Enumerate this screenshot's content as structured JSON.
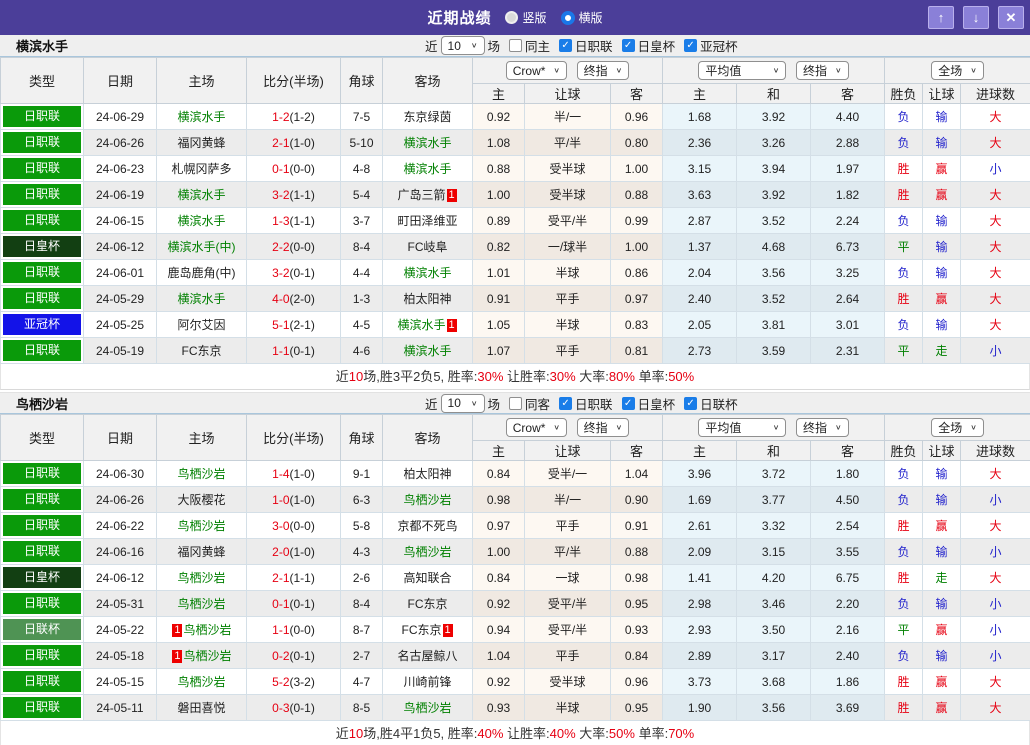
{
  "titlebar": {
    "title": "近期战绩",
    "radio_vertical": "竖版",
    "radio_horizontal": "横版",
    "selected": "横版"
  },
  "icons": {
    "up": "↑",
    "down": "↓",
    "close": "✕",
    "check": "✓",
    "chevron": "∨"
  },
  "labels": {
    "near": "近",
    "count": "10",
    "matches": "场"
  },
  "columns": {
    "type": "类型",
    "date": "日期",
    "home": "主场",
    "score": "比分(半场)",
    "corner": "角球",
    "away": "客场",
    "odds_home": "主",
    "odds_line": "让球",
    "odds_away": "客",
    "avg_home": "主",
    "avg_draw": "和",
    "avg_away": "客",
    "result_wdl": "胜负",
    "result_handicap": "让球",
    "result_goals": "进球数"
  },
  "dropdowns": {
    "source": "Crow*",
    "final": "终指",
    "average": "平均值",
    "scope": "全场"
  },
  "league_colors": {
    "日职联": "#0a9a0a",
    "日皇杯": "#123f12",
    "亚冠杯": "#1313e8",
    "日联杯": "#4f9354"
  },
  "value_colors": {
    "胜": "#e60012",
    "赢": "#e60012",
    "大": "#e60012",
    "负": "#2222cc",
    "输": "#2222cc",
    "小": "#2222cc",
    "平": "#008000",
    "走": "#008000"
  },
  "sections": [
    {
      "team": "横滨水手",
      "same_label": "同主",
      "same_checked": false,
      "leagues": [
        "日职联",
        "日皇杯",
        "亚冠杯"
      ],
      "rows": [
        {
          "league": "日职联",
          "date": "24-06-29",
          "home": {
            "name": "横滨水手",
            "green": true
          },
          "score": "1-2",
          "half": "(1-2)",
          "corners": "7-5",
          "away": {
            "name": "东京绿茵",
            "green": false
          },
          "odds": [
            "0.92",
            "半/一",
            "0.96"
          ],
          "avg": [
            "1.68",
            "3.92",
            "4.40"
          ],
          "results": [
            "负",
            "输",
            "大"
          ]
        },
        {
          "league": "日职联",
          "date": "24-06-26",
          "home": {
            "name": "福冈黄蜂",
            "green": false
          },
          "score": "2-1",
          "half": "(1-0)",
          "corners": "5-10",
          "away": {
            "name": "横滨水手",
            "green": true
          },
          "odds": [
            "1.08",
            "平/半",
            "0.80"
          ],
          "avg": [
            "2.36",
            "3.26",
            "2.88"
          ],
          "results": [
            "负",
            "输",
            "大"
          ]
        },
        {
          "league": "日职联",
          "date": "24-06-23",
          "home": {
            "name": "札幌冈萨多",
            "green": false
          },
          "score": "0-1",
          "half": "(0-0)",
          "corners": "4-8",
          "away": {
            "name": "横滨水手",
            "green": true
          },
          "odds": [
            "0.88",
            "受半球",
            "1.00"
          ],
          "avg": [
            "3.15",
            "3.94",
            "1.97"
          ],
          "results": [
            "胜",
            "赢",
            "小"
          ]
        },
        {
          "league": "日职联",
          "date": "24-06-19",
          "home": {
            "name": "横滨水手",
            "green": true
          },
          "score": "3-2",
          "half": "(1-1)",
          "corners": "5-4",
          "away": {
            "name": "广岛三箭",
            "green": false,
            "badge_after": "1"
          },
          "odds": [
            "1.00",
            "受半球",
            "0.88"
          ],
          "avg": [
            "3.63",
            "3.92",
            "1.82"
          ],
          "results": [
            "胜",
            "赢",
            "大"
          ]
        },
        {
          "league": "日职联",
          "date": "24-06-15",
          "home": {
            "name": "横滨水手",
            "green": true
          },
          "score": "1-3",
          "half": "(1-1)",
          "corners": "3-7",
          "away": {
            "name": "町田泽维亚",
            "green": false
          },
          "odds": [
            "0.89",
            "受平/半",
            "0.99"
          ],
          "avg": [
            "2.87",
            "3.52",
            "2.24"
          ],
          "results": [
            "负",
            "输",
            "大"
          ]
        },
        {
          "league": "日皇杯",
          "date": "24-06-12",
          "home": {
            "name": "横滨水手(中)",
            "green": true
          },
          "score": "2-2",
          "half": "(0-0)",
          "corners": "8-4",
          "away": {
            "name": "FC岐阜",
            "green": false
          },
          "odds": [
            "0.82",
            "一/球半",
            "1.00"
          ],
          "avg": [
            "1.37",
            "4.68",
            "6.73"
          ],
          "results": [
            "平",
            "输",
            "大"
          ]
        },
        {
          "league": "日职联",
          "date": "24-06-01",
          "home": {
            "name": "鹿岛鹿角(中)",
            "green": false
          },
          "score": "3-2",
          "half": "(0-1)",
          "corners": "4-4",
          "away": {
            "name": "横滨水手",
            "green": true
          },
          "odds": [
            "1.01",
            "半球",
            "0.86"
          ],
          "avg": [
            "2.04",
            "3.56",
            "3.25"
          ],
          "results": [
            "负",
            "输",
            "大"
          ]
        },
        {
          "league": "日职联",
          "date": "24-05-29",
          "home": {
            "name": "横滨水手",
            "green": true
          },
          "score": "4-0",
          "half": "(2-0)",
          "corners": "1-3",
          "away": {
            "name": "柏太阳神",
            "green": false
          },
          "odds": [
            "0.91",
            "平手",
            "0.97"
          ],
          "avg": [
            "2.40",
            "3.52",
            "2.64"
          ],
          "results": [
            "胜",
            "赢",
            "大"
          ]
        },
        {
          "league": "亚冠杯",
          "date": "24-05-25",
          "home": {
            "name": "阿尔艾因",
            "green": false
          },
          "score": "5-1",
          "half": "(2-1)",
          "corners": "4-5",
          "away": {
            "name": "横滨水手",
            "green": true,
            "badge_after": "1"
          },
          "odds": [
            "1.05",
            "半球",
            "0.83"
          ],
          "avg": [
            "2.05",
            "3.81",
            "3.01"
          ],
          "results": [
            "负",
            "输",
            "大"
          ]
        },
        {
          "league": "日职联",
          "date": "24-05-19",
          "home": {
            "name": "FC东京",
            "green": false
          },
          "score": "1-1",
          "half": "(0-1)",
          "corners": "4-6",
          "away": {
            "name": "横滨水手",
            "green": true
          },
          "odds": [
            "1.07",
            "平手",
            "0.81"
          ],
          "avg": [
            "2.73",
            "3.59",
            "2.31"
          ],
          "results": [
            "平",
            "走",
            "小"
          ]
        }
      ],
      "summary": [
        {
          "text": "近"
        },
        {
          "text": "10",
          "red": true
        },
        {
          "text": "场,胜3平2负5, 胜率:"
        },
        {
          "text": "30%",
          "red": true
        },
        {
          "text": " 让胜率:"
        },
        {
          "text": "30%",
          "red": true
        },
        {
          "text": " 大率:"
        },
        {
          "text": "80%",
          "red": true
        },
        {
          "text": " 单率:"
        },
        {
          "text": "50%",
          "red": true
        }
      ]
    },
    {
      "team": "鸟栖沙岩",
      "same_label": "同客",
      "same_checked": false,
      "leagues": [
        "日职联",
        "日皇杯",
        "日联杯"
      ],
      "rows": [
        {
          "league": "日职联",
          "date": "24-06-30",
          "home": {
            "name": "鸟栖沙岩",
            "green": true
          },
          "score": "1-4",
          "half": "(1-0)",
          "corners": "9-1",
          "away": {
            "name": "柏太阳神",
            "green": false
          },
          "odds": [
            "0.84",
            "受半/一",
            "1.04"
          ],
          "avg": [
            "3.96",
            "3.72",
            "1.80"
          ],
          "results": [
            "负",
            "输",
            "大"
          ]
        },
        {
          "league": "日职联",
          "date": "24-06-26",
          "home": {
            "name": "大阪樱花",
            "green": false
          },
          "score": "1-0",
          "half": "(1-0)",
          "corners": "6-3",
          "away": {
            "name": "鸟栖沙岩",
            "green": true
          },
          "odds": [
            "0.98",
            "半/一",
            "0.90"
          ],
          "avg": [
            "1.69",
            "3.77",
            "4.50"
          ],
          "results": [
            "负",
            "输",
            "小"
          ]
        },
        {
          "league": "日职联",
          "date": "24-06-22",
          "home": {
            "name": "鸟栖沙岩",
            "green": true
          },
          "score": "3-0",
          "half": "(0-0)",
          "corners": "5-8",
          "away": {
            "name": "京都不死鸟",
            "green": false
          },
          "odds": [
            "0.97",
            "平手",
            "0.91"
          ],
          "avg": [
            "2.61",
            "3.32",
            "2.54"
          ],
          "results": [
            "胜",
            "赢",
            "大"
          ]
        },
        {
          "league": "日职联",
          "date": "24-06-16",
          "home": {
            "name": "福冈黄蜂",
            "green": false
          },
          "score": "2-0",
          "half": "(1-0)",
          "corners": "4-3",
          "away": {
            "name": "鸟栖沙岩",
            "green": true
          },
          "odds": [
            "1.00",
            "平/半",
            "0.88"
          ],
          "avg": [
            "2.09",
            "3.15",
            "3.55"
          ],
          "results": [
            "负",
            "输",
            "小"
          ]
        },
        {
          "league": "日皇杯",
          "date": "24-06-12",
          "home": {
            "name": "鸟栖沙岩",
            "green": true
          },
          "score": "2-1",
          "half": "(1-1)",
          "corners": "2-6",
          "away": {
            "name": "高知联合",
            "green": false
          },
          "odds": [
            "0.84",
            "一球",
            "0.98"
          ],
          "avg": [
            "1.41",
            "4.20",
            "6.75"
          ],
          "results": [
            "胜",
            "走",
            "大"
          ]
        },
        {
          "league": "日职联",
          "date": "24-05-31",
          "home": {
            "name": "鸟栖沙岩",
            "green": true
          },
          "score": "0-1",
          "half": "(0-1)",
          "corners": "8-4",
          "away": {
            "name": "FC东京",
            "green": false
          },
          "odds": [
            "0.92",
            "受平/半",
            "0.95"
          ],
          "avg": [
            "2.98",
            "3.46",
            "2.20"
          ],
          "results": [
            "负",
            "输",
            "小"
          ]
        },
        {
          "league": "日联杯",
          "date": "24-05-22",
          "home": {
            "name": "鸟栖沙岩",
            "green": true,
            "badge_before": "1"
          },
          "score": "1-1",
          "half": "(0-0)",
          "corners": "8-7",
          "away": {
            "name": "FC东京",
            "green": false,
            "badge_after": "1"
          },
          "odds": [
            "0.94",
            "受平/半",
            "0.93"
          ],
          "avg": [
            "2.93",
            "3.50",
            "2.16"
          ],
          "results": [
            "平",
            "赢",
            "小"
          ]
        },
        {
          "league": "日职联",
          "date": "24-05-18",
          "home": {
            "name": "鸟栖沙岩",
            "green": true,
            "badge_before": "1"
          },
          "score": "0-2",
          "half": "(0-1)",
          "corners": "2-7",
          "away": {
            "name": "名古屋鲸八",
            "green": false
          },
          "odds": [
            "1.04",
            "平手",
            "0.84"
          ],
          "avg": [
            "2.89",
            "3.17",
            "2.40"
          ],
          "results": [
            "负",
            "输",
            "小"
          ]
        },
        {
          "league": "日职联",
          "date": "24-05-15",
          "home": {
            "name": "鸟栖沙岩",
            "green": true
          },
          "score": "5-2",
          "half": "(3-2)",
          "corners": "4-7",
          "away": {
            "name": "川崎前锋",
            "green": false
          },
          "odds": [
            "0.92",
            "受半球",
            "0.96"
          ],
          "avg": [
            "3.73",
            "3.68",
            "1.86"
          ],
          "results": [
            "胜",
            "赢",
            "大"
          ]
        },
        {
          "league": "日职联",
          "date": "24-05-11",
          "home": {
            "name": "磐田喜悦",
            "green": false
          },
          "score": "0-3",
          "half": "(0-1)",
          "corners": "8-5",
          "away": {
            "name": "鸟栖沙岩",
            "green": true
          },
          "odds": [
            "0.93",
            "半球",
            "0.95"
          ],
          "avg": [
            "1.90",
            "3.56",
            "3.69"
          ],
          "results": [
            "胜",
            "赢",
            "大"
          ]
        }
      ],
      "summary": [
        {
          "text": "近"
        },
        {
          "text": "10",
          "red": true
        },
        {
          "text": "场,胜4平1负5, 胜率:"
        },
        {
          "text": "40%",
          "red": true
        },
        {
          "text": " 让胜率:"
        },
        {
          "text": "40%",
          "red": true
        },
        {
          "text": " 大率:"
        },
        {
          "text": "50%",
          "red": true
        },
        {
          "text": " 单率:"
        },
        {
          "text": "70%",
          "red": true
        }
      ]
    }
  ]
}
